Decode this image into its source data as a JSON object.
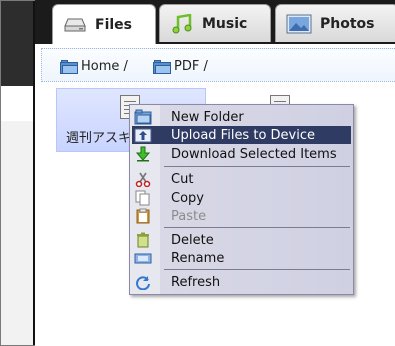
{
  "tabs": [
    {
      "label": "Files",
      "icon": "drive-icon"
    },
    {
      "label": "Music",
      "icon": "music-note-icon"
    },
    {
      "label": "Photos",
      "icon": "picture-icon"
    }
  ],
  "breadcrumb": [
    {
      "label": "Home /",
      "icon": "folder-icon"
    },
    {
      "label": "PDF /",
      "icon": "folder-icon"
    }
  ],
  "files": [
    {
      "label": "週刊アスキ",
      "icon": "document-icon",
      "selected": true
    },
    {
      "label": "",
      "icon": "document-icon",
      "selected": false
    }
  ],
  "menu": {
    "items": [
      {
        "label": "New Folder",
        "icon": "new-folder-icon",
        "state": "normal"
      },
      {
        "label": "Upload Files to Device",
        "icon": "upload-icon",
        "state": "highlighted"
      },
      {
        "label": "Download Selected Items",
        "icon": "download-icon",
        "state": "normal"
      },
      {
        "label": "Cut",
        "icon": "scissors-icon",
        "state": "normal"
      },
      {
        "label": "Copy",
        "icon": "copy-icon",
        "state": "normal"
      },
      {
        "label": "Paste",
        "icon": "paste-icon",
        "state": "disabled"
      },
      {
        "label": "Delete",
        "icon": "trash-icon",
        "state": "normal"
      },
      {
        "label": "Rename",
        "icon": "rename-icon",
        "state": "normal"
      },
      {
        "label": "Refresh",
        "icon": "refresh-icon",
        "state": "normal"
      }
    ]
  },
  "colors": {
    "highlight": "#2f3b62",
    "menu_background": "#d8d8e6",
    "selection": "#c9d4ff",
    "topbar": "#1b1b1b"
  }
}
